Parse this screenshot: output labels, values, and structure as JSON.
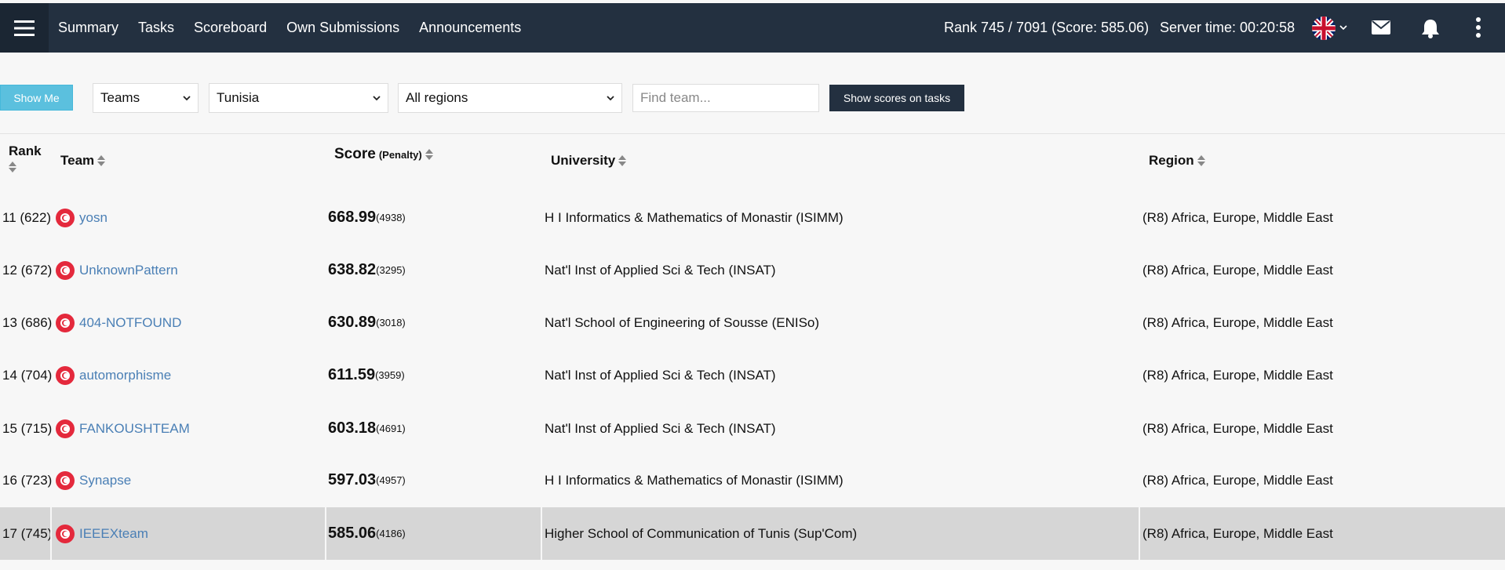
{
  "nav": {
    "items": [
      "Summary",
      "Tasks",
      "Scoreboard",
      "Own Submissions",
      "Announcements"
    ],
    "rank_info": "Rank 745 / 7091 (Score: 585.06)",
    "server_time": "Server time: 00:20:58"
  },
  "toolbar": {
    "show_me": "Show Me",
    "type_select": "Teams",
    "country_select": "Tunisia",
    "region_select": "All regions",
    "search_placeholder": "Find team...",
    "show_scores": "Show scores on tasks"
  },
  "table": {
    "headers": {
      "rank": "Rank",
      "team": "Team",
      "score": "Score",
      "penalty": "(Penalty)",
      "university": "University",
      "region": "Region"
    },
    "rows": [
      {
        "rank": "11 (622)",
        "team": "yosn",
        "score": "668.99",
        "penalty": "(4938)",
        "university": "H I Informatics & Mathematics of Monastir (ISIMM)",
        "region": "(R8) Africa, Europe, Middle East"
      },
      {
        "rank": "12 (672)",
        "team": "UnknownPattern",
        "score": "638.82",
        "penalty": "(3295)",
        "university": "Nat'l Inst of Applied Sci & Tech (INSAT)",
        "region": "(R8) Africa, Europe, Middle East"
      },
      {
        "rank": "13 (686)",
        "team": "404-NOTFOUND",
        "score": "630.89",
        "penalty": "(3018)",
        "university": "Nat'l School of Engineering of Sousse (ENISo)",
        "region": "(R8) Africa, Europe, Middle East"
      },
      {
        "rank": "14 (704)",
        "team": "automorphisme",
        "score": "611.59",
        "penalty": "(3959)",
        "university": "Nat'l Inst of Applied Sci & Tech (INSAT)",
        "region": "(R8) Africa, Europe, Middle East"
      },
      {
        "rank": "15 (715)",
        "team": "FANKOUSHTEAM",
        "score": "603.18",
        "penalty": "(4691)",
        "university": "Nat'l Inst of Applied Sci & Tech (INSAT)",
        "region": "(R8) Africa, Europe, Middle East"
      },
      {
        "rank": "16 (723)",
        "team": "Synapse",
        "score": "597.03",
        "penalty": "(4957)",
        "university": "H I Informatics & Mathematics of Monastir (ISIMM)",
        "region": "(R8) Africa, Europe, Middle East"
      },
      {
        "rank": "17 (745)",
        "team": "IEEEXteam",
        "score": "585.06",
        "penalty": "(4186)",
        "university": "Higher School of Communication of Tunis (Sup'Com)",
        "region": "(R8) Africa, Europe, Middle East",
        "highlighted": true
      }
    ]
  },
  "colors": {
    "navbar": "#233040",
    "show_me": "#5bc0de",
    "team_link": "#4a7fb5",
    "flag_icon": "#e4293c",
    "highlight_row": "#d6d6d6"
  },
  "icons": [
    "hamburger-menu-icon",
    "uk-flag-icon",
    "chevron-down-icon",
    "mail-icon",
    "bell-icon",
    "kebab-menu-icon",
    "tunisia-flag-icon",
    "sort-icon"
  ]
}
